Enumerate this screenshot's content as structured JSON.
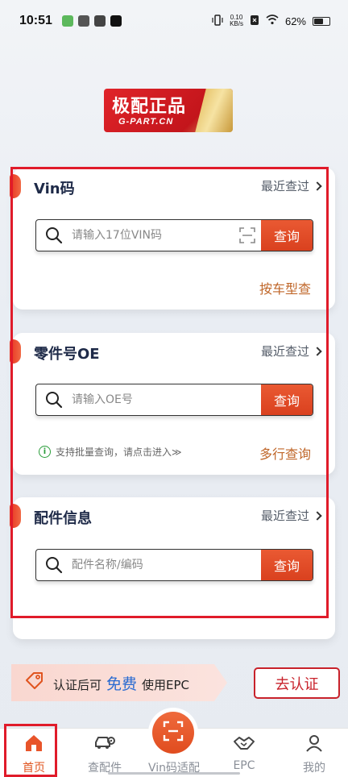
{
  "status_bar": {
    "time": "10:51",
    "net_speed_value": "0.10",
    "net_speed_unit": "KB/s",
    "battery": "62%"
  },
  "logo": {
    "cn": "极配正品",
    "en": "G-PART.CN"
  },
  "vin_card": {
    "title": "Vin码",
    "recent": "最近查过",
    "placeholder": "请输入17位VIN码",
    "query": "查询",
    "link": "按车型查"
  },
  "oe_card": {
    "title": "零件号OE",
    "recent": "最近查过",
    "placeholder": "请输入OE号",
    "query": "查询",
    "hint": "支持批量查询，请点击进入≫",
    "link": "多行查询"
  },
  "parts_card": {
    "title": "配件信息",
    "recent": "最近查过",
    "placeholder": "配件名称/编码",
    "query": "查询"
  },
  "cert": {
    "prefix": "认证后可",
    "free": "免费",
    "suffix": "使用EPC",
    "button": "去认证"
  },
  "nav": {
    "home": "首页",
    "parts": "查配件",
    "vin": "Vin码适配",
    "epc": "EPC",
    "mine": "我的"
  },
  "colors": {
    "accent": "#e0541f",
    "highlight_frame": "#e01b2a",
    "link": "#c0672a",
    "free_text": "#2a6bd1"
  }
}
